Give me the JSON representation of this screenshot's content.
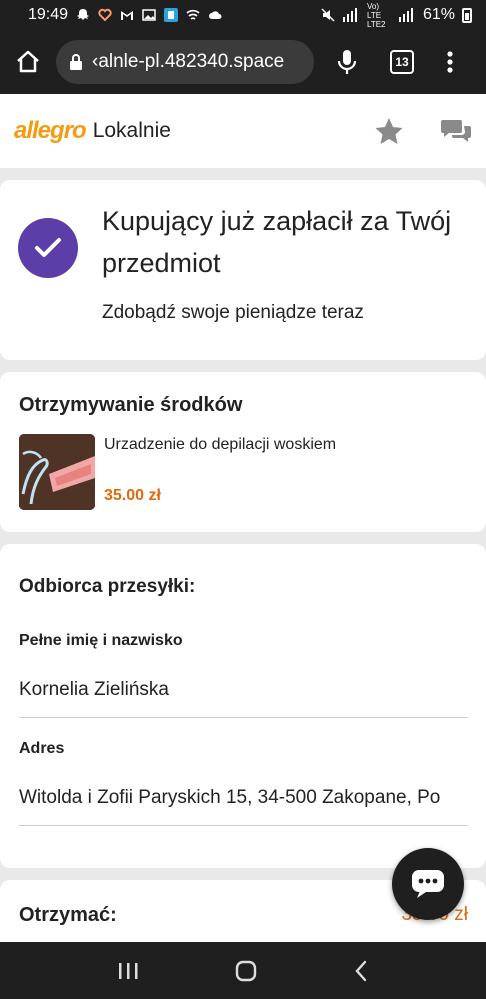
{
  "status_bar": {
    "time": "19:49",
    "network": "Vo) LTE LTE2",
    "battery": "61%"
  },
  "browser": {
    "url": "‹alnle-pl.482340.space",
    "tab_count": "13"
  },
  "header": {
    "logo": "allegro",
    "logo_sub": "Lokalnie",
    "icons": [
      "star-icon",
      "chat-bubbles-icon"
    ]
  },
  "payment_card": {
    "title": "Kupujący już zapłacił za Twój przedmiot",
    "subtitle": "Zdobądź swoje pieniądze teraz",
    "accent": "#5b3ea7"
  },
  "funds_card": {
    "title": "Otrzymywanie środków",
    "item_name": "Urzadzenie do depilacji woskiem",
    "item_price": "35.00 zł"
  },
  "recipient_card": {
    "title": "Odbiorca przesyłki:",
    "name_label": "Pełne imię i nazwisko",
    "name_value": "Kornelia Zielińska",
    "address_label": "Adres",
    "address_value": "Witolda i Zofii Paryskich 15, 34-500 Zakopane, Po"
  },
  "receive_card": {
    "label": "Otrzymać:",
    "price": "35.00 zł"
  },
  "colors": {
    "price": "#e06a0f",
    "bar": "#1f1f1f"
  }
}
